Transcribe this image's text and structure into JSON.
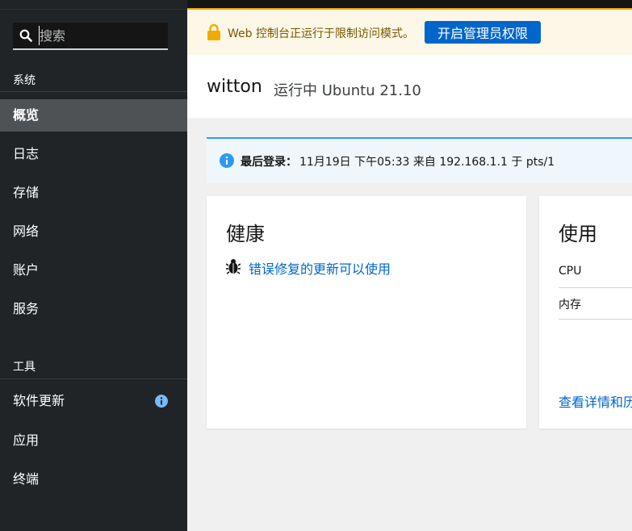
{
  "search": {
    "placeholder": "搜索"
  },
  "sidebar": {
    "section_system": "系统",
    "system_items": [
      {
        "label": "概览"
      },
      {
        "label": "日志"
      },
      {
        "label": "存储"
      },
      {
        "label": "网络"
      },
      {
        "label": "账户"
      },
      {
        "label": "服务"
      }
    ],
    "section_tools": "工具",
    "tool_items": [
      {
        "label": "软件更新"
      },
      {
        "label": "应用"
      },
      {
        "label": "终端"
      }
    ]
  },
  "banner": {
    "message": "Web 控制台正运行于限制访问模式。",
    "button_label": "开启管理员权限"
  },
  "header": {
    "hostname": "witton",
    "os_status": "运行中 Ubuntu 21.10"
  },
  "login": {
    "label": "最后登录：",
    "text": "11月19日 下午05:33 来自 192.168.1.1 于 pts/1"
  },
  "health": {
    "title": "健康",
    "updates_link": "错误修复的更新可以使用"
  },
  "usage": {
    "title": "使用",
    "rows": [
      "CPU",
      "内存"
    ],
    "details_link": "查看详情和历"
  },
  "colors": {
    "sidebar_bg": "#212427",
    "active_item_bg": "#4f5255",
    "primary": "#0066cc",
    "warning_bg": "#fdf7e7",
    "warning_icon": "#f0ab00",
    "info_icon": "#2b9af3"
  }
}
